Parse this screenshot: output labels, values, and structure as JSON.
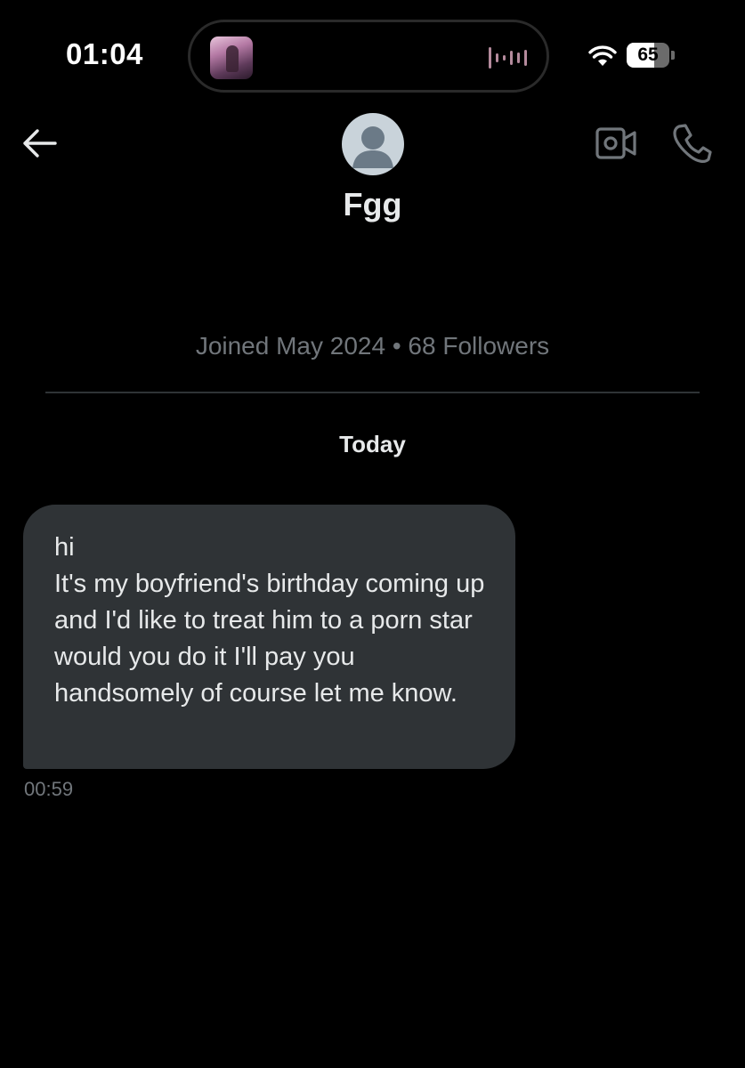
{
  "status_bar": {
    "time": "01:04",
    "battery_level": "65",
    "battery_fraction": 0.65,
    "icons": [
      "wifi-icon",
      "battery-icon",
      "audio-waveform-icon"
    ]
  },
  "header": {
    "back_icon": "arrow-left-icon",
    "contact_name": "Fgg",
    "video_icon": "video-camera-icon",
    "phone_icon": "phone-icon"
  },
  "profile": {
    "meta": "Joined May 2024 • 68 Followers"
  },
  "conversation": {
    "date_label": "Today",
    "messages": [
      {
        "text": "hi\nIt's my boyfriend's birthday coming up and I'd like to treat him to a porn star would you do it I'll pay you handsomely of course let me know.",
        "time": "00:59"
      }
    ]
  },
  "colors": {
    "background": "#000000",
    "bubble": "#2f3336",
    "primary_text": "#e7e9ea",
    "secondary_text": "#71767b",
    "icon_gray": "#71767b"
  }
}
